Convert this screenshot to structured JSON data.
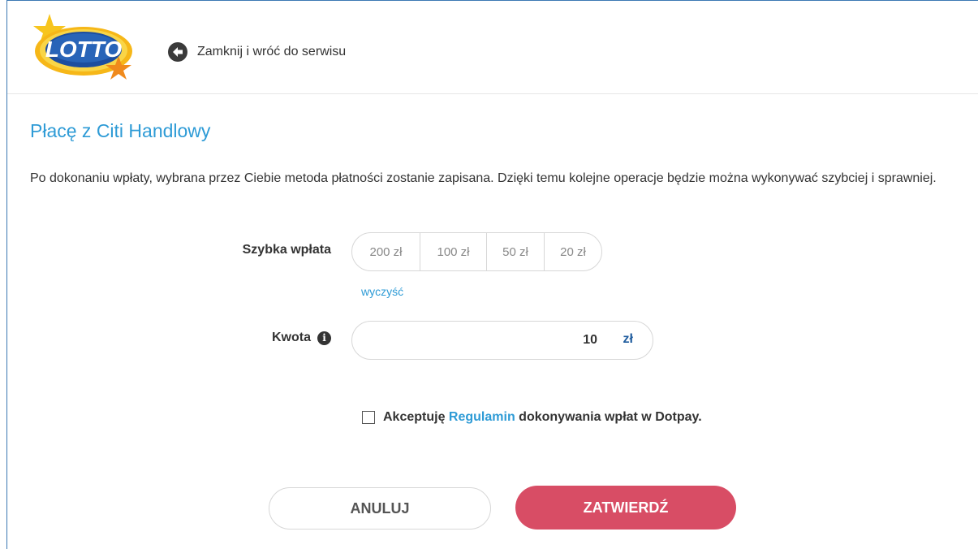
{
  "header": {
    "logo_text": "LOTTO",
    "back_label": "Zamknij i wróć do serwisu"
  },
  "main": {
    "title": "Płacę z Citi Handlowy",
    "description": "Po dokonaniu wpłaty, wybrana przez Ciebie metoda płatności zostanie zapisana. Dzięki temu kolejne operacje będzie można wykonywać szybciej i sprawniej."
  },
  "quick_payment": {
    "label": "Szybka wpłata",
    "options": [
      "200 zł",
      "100 zł",
      "50 zł",
      "20 zł"
    ],
    "clear_label": "wyczyść"
  },
  "amount": {
    "label": "Kwota",
    "value": "10",
    "currency": "zł"
  },
  "terms": {
    "prefix": "Akceptuję",
    "link": "Regulamin",
    "suffix": "dokonywania wpłat w Dotpay.",
    "checked": false
  },
  "actions": {
    "cancel_label": "ANULUJ",
    "confirm_label": "ZATWIERDŹ"
  },
  "colors": {
    "accent_blue": "#2e9bd6",
    "confirm_red": "#d84d65",
    "currency_blue": "#1f5c9e"
  },
  "icons": {
    "back": "arrow-left-circle-icon",
    "info": "info-circle-icon"
  }
}
